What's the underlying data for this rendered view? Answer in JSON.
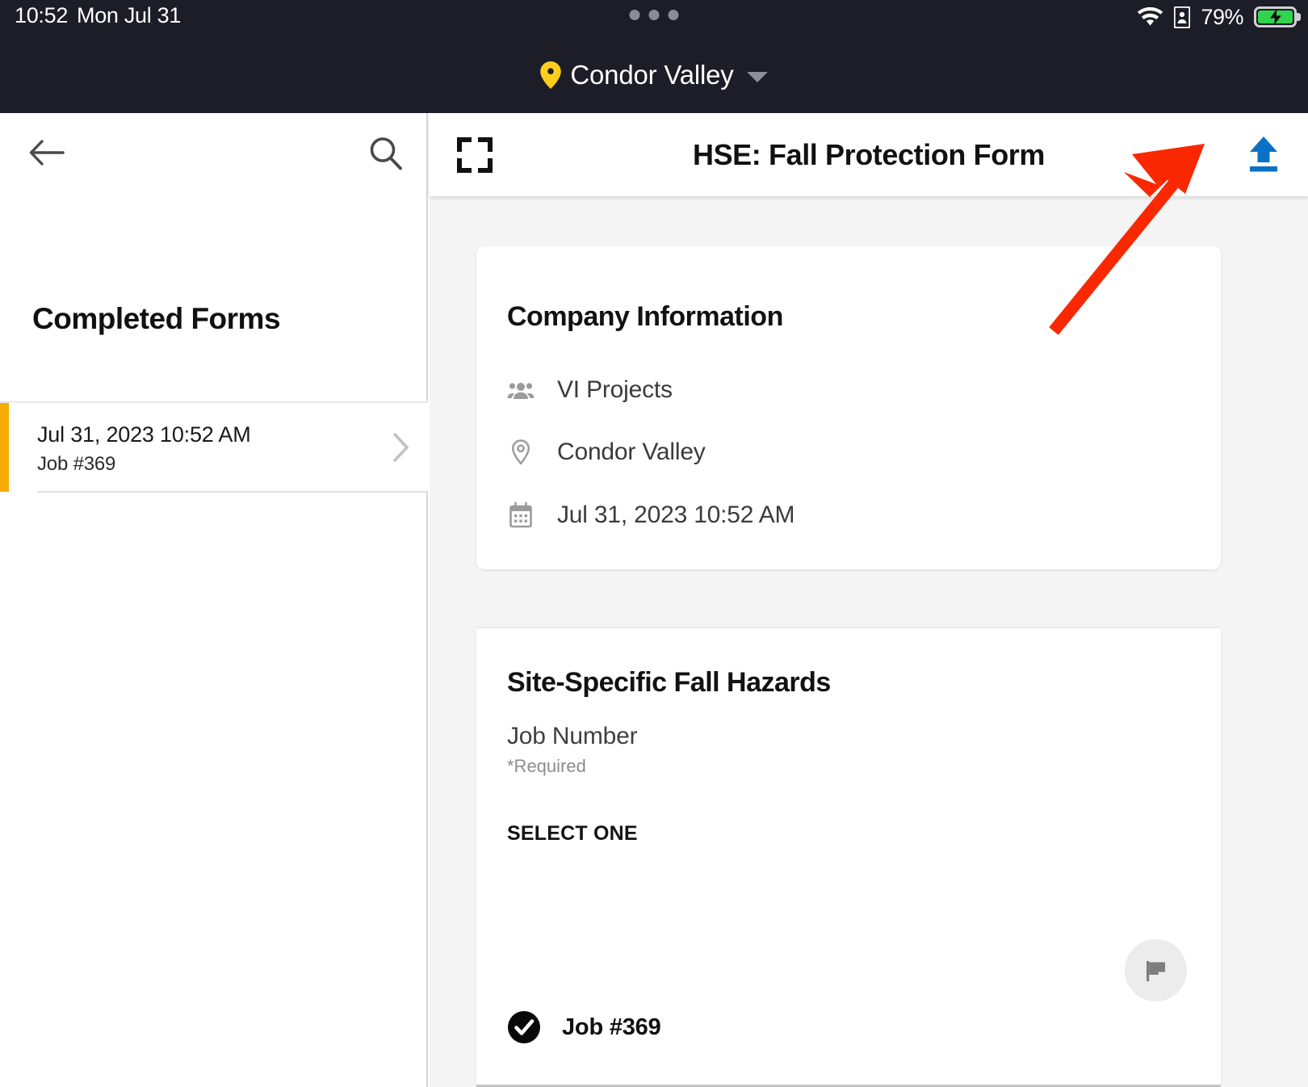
{
  "status_bar": {
    "time": "10:52",
    "date": "Mon Jul 31",
    "battery_percent": "79%",
    "wifi_icon": "wifi-icon",
    "id_card_icon": "id-card-icon",
    "battery_icon": "battery-charging-icon",
    "dots_indicator": "three-dots-indicator"
  },
  "location_header": {
    "pin_icon": "location-pin-icon",
    "name": "Condor Valley",
    "caret_icon": "chevron-down-icon"
  },
  "sidebar": {
    "back_icon": "back-arrow-icon",
    "search_icon": "search-icon",
    "title": "Completed Forms",
    "rows": [
      {
        "title": "Jul 31, 2023 10:52 AM",
        "subtitle": "Job #369",
        "chevron_icon": "chevron-right-icon",
        "accent_color": "#F8AC00"
      }
    ]
  },
  "pane_header": {
    "fullscreen_icon": "fullscreen-icon",
    "title": "HSE: Fall Protection Form",
    "upload_icon": "upload-icon",
    "upload_color": "#0A72C6"
  },
  "company_card": {
    "heading": "Company Information",
    "rows": [
      {
        "icon": "people-group-icon",
        "text": "VI Projects"
      },
      {
        "icon": "location-pin-outline-icon",
        "text": "Condor Valley"
      },
      {
        "icon": "calendar-icon",
        "text": "Jul 31, 2023 10:52 AM"
      }
    ]
  },
  "hazards_card": {
    "heading": "Site-Specific Fall Hazards",
    "field_label": "Job Number",
    "required_note": "*Required",
    "select_instruction": "SELECT ONE",
    "flag_icon": "flag-icon",
    "options": [
      {
        "label": "Job #369",
        "selected": true,
        "icon": "check-circle-icon"
      }
    ]
  },
  "annotation": {
    "arrow_icon": "red-arrow-annotation",
    "color": "#FA2800"
  },
  "theme": {
    "chrome_bg": "#1C1D26",
    "pane_bg": "#F4F4F4",
    "accent_yellow": "#F8AC00",
    "upload_blue": "#0A72C6",
    "battery_green": "#32D44E"
  }
}
